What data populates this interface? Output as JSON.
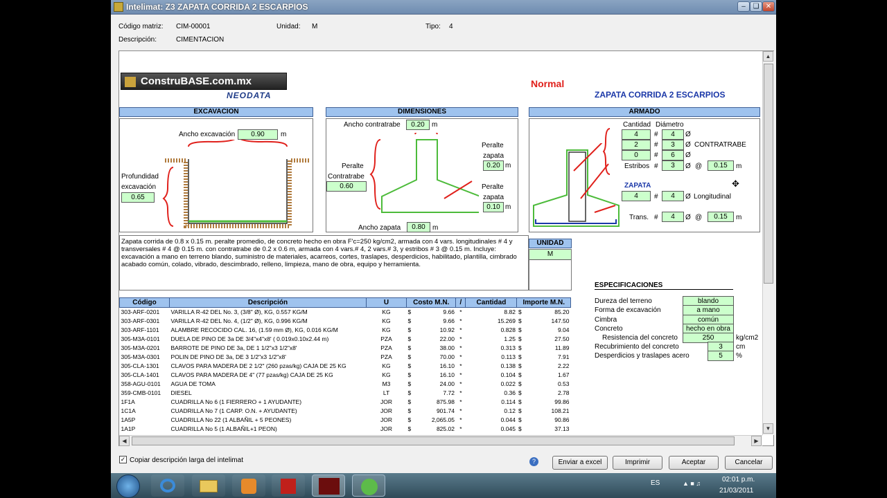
{
  "window": {
    "title": "Intelimat: Z3 ZAPATA CORRIDA 2 ESCARPIOS"
  },
  "header": {
    "codigo_label": "Código matriz:",
    "codigo_value": "CIM-00001",
    "unidad_label": "Unidad:",
    "unidad_value": "M",
    "tipo_label": "Tipo:",
    "tipo_value": "4",
    "descripcion_label": "Descripción:",
    "descripcion_value": "CIMENTACION"
  },
  "brand": {
    "logo": "ConstruBASE.com.mx",
    "sub": "NEODATA"
  },
  "mode": "Normal",
  "item_title": "ZAPATA CORRIDA 2 ESCARPIOS",
  "excavacion": {
    "header": "EXCAVACION",
    "ancho_label": "Ancho excavación",
    "ancho_value": "0.90",
    "ancho_unit": "m",
    "prof_label1": "Profundidad",
    "prof_label2": "excavación",
    "prof_value": "0.65"
  },
  "dimensiones": {
    "header": "DIMENSIONES",
    "ancho_contratrabe_label": "Ancho contratrabe",
    "ancho_contratrabe_value": "0.20",
    "unit": "m",
    "peralte_ct_label1": "Peralte",
    "peralte_ct_label2": "Contratrabe",
    "peralte_ct_value": "0.60",
    "peralte_zap_label1": "Peralte",
    "peralte_zap_label2": "zapata",
    "peralte_zap_value": "0.20",
    "peralte_zap2_label1": "Peralte",
    "peralte_zap2_label2": "zapata",
    "peralte_zap2_value": "0.10",
    "ancho_zapata_label": "Ancho zapata",
    "ancho_zapata_value": "0.80"
  },
  "armado": {
    "header": "ARMADO",
    "cantidad_label": "Cantidad",
    "diametro_label": "Diámetro",
    "hash": "#",
    "phi": "Ø",
    "rows": [
      {
        "cant": "4",
        "diam": "4"
      },
      {
        "cant": "2",
        "diam": "3"
      },
      {
        "cant": "0",
        "diam": "6"
      }
    ],
    "contratrabe_label": "CONTRATRABE",
    "estribos_label": "Estribos",
    "estribos_num": "3",
    "at": "@",
    "estribos_sep": "0.15",
    "unit": "m",
    "zapata_label": "ZAPATA",
    "zap_cant": "4",
    "zap_diam": "4",
    "longitudinal_label": "Longitudinal",
    "trans_label": "Trans.",
    "trans_num": "4",
    "trans_sep": "0.15"
  },
  "long_description": "Zapata corrida de 0.8 x 0.15 m. peralte promedio, de concreto hecho en obra F'c=250 kg/cm2, armada con 4 vars. longitudinales # 4 y transversales # 4 @ 0.15 m. con contratrabe de 0.2 x 0.6 m, armada con 4 vars.# 4, 2 vars.# 3, y estribos # 3 @ 0.15 m. Incluye: excavación a mano en terreno blando, suministro de materiales, acarreos, cortes, traslapes, desperdicios, habilitado, plantilla, cimbrado acabado común, colado, vibrado, descimbrado, relleno, limpieza, mano de obra, equipo y herramienta.",
  "unidad_box": {
    "header": "UNIDAD",
    "value": "M"
  },
  "table": {
    "headers": [
      "Código",
      "Descripción",
      "U",
      "Costo M.N.",
      "/",
      "Cantidad",
      "Importe M.N."
    ],
    "currency": "$",
    "star": "*",
    "rows": [
      {
        "code": "303-ARF-0201",
        "desc": "VARILLA R-42 DEL No. 3, (3/8\" Ø), KG,  0.557 KG/M",
        "u": "KG",
        "cost": "9.66",
        "qty": "8.82",
        "imp": "85.20"
      },
      {
        "code": "303-ARF-0301",
        "desc": "VARILLA R-42 DEL No. 4, (1/2\" Ø), KG,  0.996 KG/M",
        "u": "KG",
        "cost": "9.66",
        "qty": "15.269",
        "imp": "147.50"
      },
      {
        "code": "303-ARF-1101",
        "desc": "ALAMBRE RECOCIDO CAL. 16, (1.59 mm Ø), KG, 0.016 KG/M",
        "u": "KG",
        "cost": "10.92",
        "qty": "0.828",
        "imp": "9.04"
      },
      {
        "code": "305-M3A-0101",
        "desc": "DUELA DE PINO DE 3a DE 3/4\"x4\"x8' ( 0.019x0.10x2.44 m)",
        "u": "PZA",
        "cost": "22.00",
        "qty": "1.25",
        "imp": "27.50"
      },
      {
        "code": "305-M3A-0201",
        "desc": "BARROTE DE PINO DE 3a, DE 1 1/2\"x3 1/2\"x8'",
        "u": "PZA",
        "cost": "38.00",
        "qty": "0.313",
        "imp": "11.89"
      },
      {
        "code": "305-M3A-0301",
        "desc": "POLIN DE PINO DE 3a, DE 3 1/2\"x3 1/2\"x8'",
        "u": "PZA",
        "cost": "70.00",
        "qty": "0.113",
        "imp": "7.91"
      },
      {
        "code": "305-CLA-1301",
        "desc": "CLAVOS PARA MADERA DE 2 1/2\" (260 pzas/kg) CAJA DE 25 KG",
        "u": "KG",
        "cost": "16.10",
        "qty": "0.138",
        "imp": "2.22"
      },
      {
        "code": "305-CLA-1401",
        "desc": "CLAVOS PARA MADERA DE 4\" (77 pzas/kg) CAJA DE 25 KG",
        "u": "KG",
        "cost": "16.10",
        "qty": "0.104",
        "imp": "1.67"
      },
      {
        "code": "358-AGU-0101",
        "desc": "AGUA DE TOMA",
        "u": "M3",
        "cost": "24.00",
        "qty": "0.022",
        "imp": "0.53"
      },
      {
        "code": "359-CMB-0101",
        "desc": "DIESEL",
        "u": "LT",
        "cost": "7.72",
        "qty": "0.36",
        "imp": "2.78"
      },
      {
        "code": "1F1A",
        "desc": "CUADRILLA No  6 (1 FIERRERO + 1 AYUDANTE)",
        "u": "JOR",
        "cost": "875.98",
        "qty": "0.114",
        "imp": "99.86"
      },
      {
        "code": "1C1A",
        "desc": "CUADRILLA No  7 (1 CARP. O.N. + AYUDANTE)",
        "u": "JOR",
        "cost": "901.74",
        "qty": "0.12",
        "imp": "108.21"
      },
      {
        "code": "1A5P",
        "desc": "CUADRILLA No 22  (1 ALBAÑIL + 5 PEONES)",
        "u": "JOR",
        "cost": "2,065.05",
        "qty": "0.044",
        "imp": "90.86"
      },
      {
        "code": "1A1P",
        "desc": "CUADRILLA No  5  (1 ALBAÑIL+1 PEON)",
        "u": "JOR",
        "cost": "825.02",
        "qty": "0.045",
        "imp": "37.13"
      }
    ]
  },
  "especificaciones": {
    "title": "ESPECIFICACIONES",
    "dureza_label": "Dureza del terreno",
    "dureza_value": "blando",
    "forma_label": "Forma de excavación",
    "forma_value": "a mano",
    "cimbra_label": "Cimbra",
    "cimbra_value": "común",
    "concreto_label": "Concreto",
    "concreto_value": "hecho en obra",
    "resistencia_label": "Resistencia del concreto",
    "resistencia_value": "250",
    "resistencia_unit": "kg/cm2",
    "recub_label": "Recubrimiento del concreto",
    "recub_value": "3",
    "recub_unit": "cm",
    "desp_label": "Desperdicios y traslapes acero",
    "desp_value": "5",
    "desp_unit": "%"
  },
  "footer": {
    "checkbox_label": "Copiar descripción larga del intelimat",
    "btn_excel": "Enviar a excel",
    "btn_print": "Imprimir",
    "btn_ok": "Aceptar",
    "btn_cancel": "Cancelar"
  },
  "taskbar": {
    "lang": "ES",
    "time": "02:01 p.m.",
    "date": "21/03/2011"
  }
}
